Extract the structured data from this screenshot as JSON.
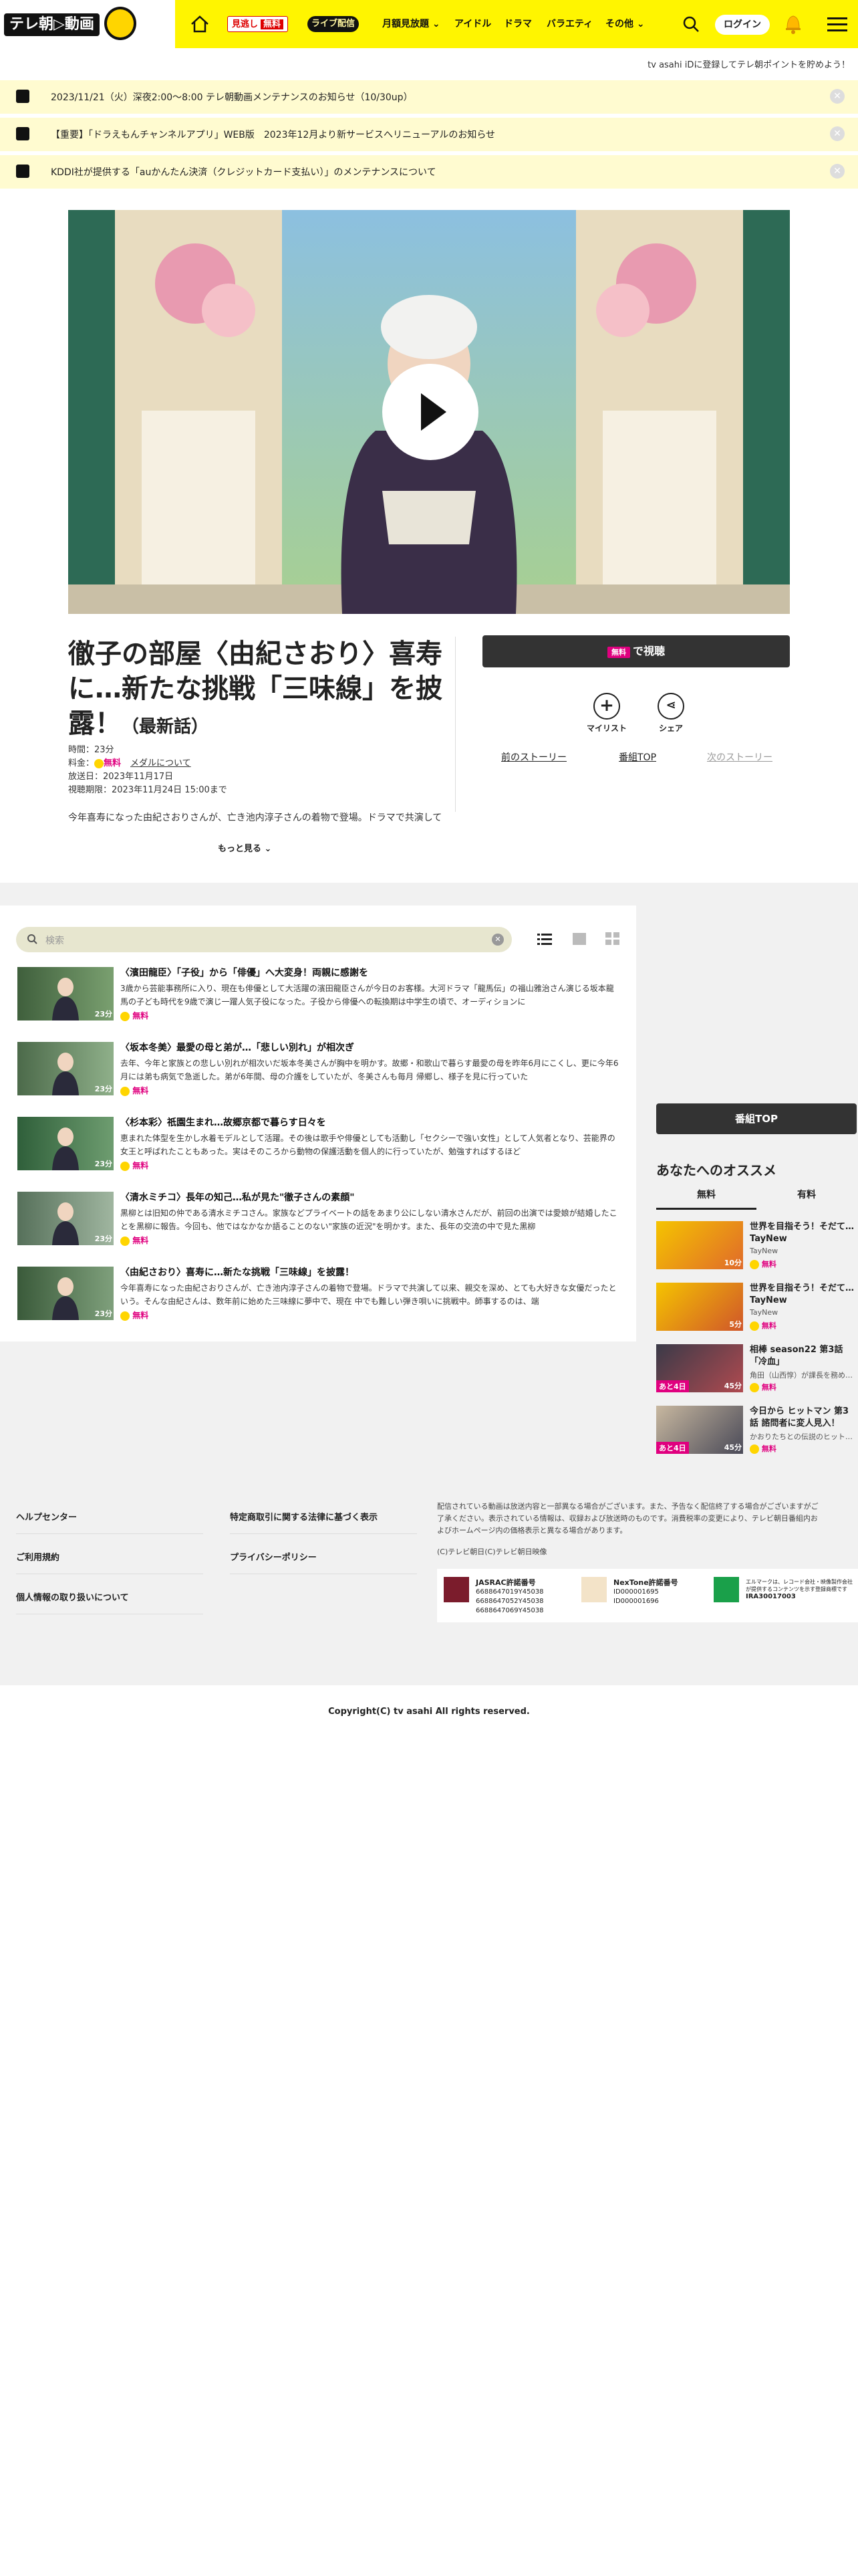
{
  "header": {
    "logo_text": "テレ朝▷動画",
    "mitoshi_label": "見逃し",
    "mitoshi_free": "無料",
    "live_label": "ライブ配信",
    "nav": [
      "月額見放題",
      "アイドル",
      "ドラマ",
      "バラエティ",
      "その他"
    ],
    "login_label": "ログイン",
    "subline": "tv asahi iDに登録してテレ朝ポイントを貯めよう！",
    "colors": {
      "brand_yellow": "#fff500",
      "free_pink": "#e0007f"
    }
  },
  "notices": [
    "2023/11/21（火）深夜2:00〜8:00 テレ朝動画メンテナンスのお知らせ（10/30up）",
    "【重要】「ドラえもんチャンネルアプリ」WEB版　2023年12月より新サービスへリニューアルのお知らせ",
    "KDDI社が提供する「auかんたん決済（クレジットカード支払い）」のメンテナンスについて"
  ],
  "episode": {
    "title": "徹子の部屋〈由紀さおり〉喜寿に…新たな挑戦「三味線」を披露！",
    "latest": "（最新話）",
    "time": "時間：23分",
    "price_prefix": "料金：",
    "price": "無料",
    "media_link": "メダルについて",
    "aired": "放送日：2023年11月17日",
    "expires": "視聴期限：2023年11月24日 15:00まで",
    "description": "今年喜寿になった由紀さおりさんが、亡き池内淳子さんの着物で登場。ドラマで共演して以",
    "more_label": "もっと見る"
  },
  "actions": {
    "watch_free": "無料",
    "watch_label": "で視聴",
    "mylist": "マイリスト",
    "share": "シェア",
    "prev_story": "前のストーリー",
    "program_top": "番組TOP",
    "next_story": "次のストーリー"
  },
  "list": {
    "search_placeholder": "検索",
    "episodes": [
      {
        "title": "〈濱田龍臣〉「子役」から「俳優」へ大変身！両親に感謝を",
        "desc": "3歳から芸能事務所に入り、現在も俳優として大活躍の濱田龍臣さんが今日のお客様。大河ドラマ「龍馬伝」の福山雅治さん演じる坂本龍馬の子ども時代を9歳で演じ一躍人気子役になった。子役から俳優への転換期は中学生の頃で、オーディションに",
        "dur": "23分",
        "free": "無料"
      },
      {
        "title": "〈坂本冬美〉最愛の母と弟が…「悲しい別れ」が相次ぎ",
        "desc": "去年、今年と家族との悲しい別れが相次いだ坂本冬美さんが胸中を明かす。故郷・和歌山で暮らす最愛の母を昨年6月にこくし、更に今年6月には弟も病気で急逝した。弟が6年間、母の介護をしていたが、冬美さんも毎月 帰郷し、様子を見に行っていた",
        "dur": "23分",
        "free": "無料"
      },
      {
        "title": "〈杉本彩〉祇園生まれ…故郷京都で暮らす日々を",
        "desc": "恵まれた体型を生かし水着モデルとして活躍。その後は歌手や俳優としても活動し「セクシーで強い女性」として人気者となり、芸能界の女王と呼ばれたこともあった。実はそのころから動物の保護活動を個人的に行っていたが、勉強すればするほど",
        "dur": "23分",
        "free": "無料"
      },
      {
        "title": "〈清水ミチコ〉長年の知己…私が見た\"徹子さんの素顔\"",
        "desc": "黒柳とは旧知の仲である清水ミチコさん。家族などプライベートの話をあまり公にしない清水さんだが、前回の出演では愛娘が結婚したことを黒柳に報告。今回も、他ではなかなか語ることのない\"家族の近況\"を明かす。また、長年の交流の中で見た黒柳",
        "dur": "23分",
        "free": "無料"
      },
      {
        "title": "〈由紀さおり〉喜寿に…新たな挑戦「三味線」を披露！",
        "desc": "今年喜寿になった由紀さおりさんが、亡き池内淳子さんの着物で登場。ドラマで共演して以来、親交を深め、とても大好きな女優だったという。そんな由紀さんは、数年前に始めた三味線に夢中で、現在 中でも難しい弾き唄いに挑戦中。師事するのは、端",
        "dur": "23分",
        "free": "無料"
      }
    ]
  },
  "sidebar": {
    "program_top": "番組TOP",
    "rec_heading": "あなたへのオススメ",
    "tabs": [
      "無料",
      "有料"
    ],
    "recs": [
      {
        "title": "世界を目指そう！そだて…TayNew",
        "sub": "TayNew",
        "dur": "10分",
        "left": "",
        "free": "無料"
      },
      {
        "title": "世界を目指そう！そだて…TayNew",
        "sub": "TayNew",
        "dur": "5分",
        "left": "",
        "free": "無料"
      },
      {
        "title": "相棒 season22 第3話「冷血」",
        "sub": "角田（山西惇）が課長を務め…",
        "dur": "45分",
        "left": "あと4日",
        "free": "無料"
      },
      {
        "title": "今日から ヒットマン 第3話 諮問者に変人見入！",
        "sub": "かおりたちとの伝説のヒット…",
        "dur": "45分",
        "left": "あと4日",
        "free": "無料"
      }
    ]
  },
  "footer": {
    "links_left": [
      "ヘルプセンター",
      "ご利用規約",
      "個人情報の取り扱いについて"
    ],
    "links_mid": [
      "特定商取引に関する法律に基づく表示",
      "プライバシーポリシー"
    ],
    "note": "配信されている動画は放送内容と一部異なる場合がございます。また、予告なく配信終了する場合がございますがご了承ください。表示されている情報は、収録および放送時のものです。消費税率の変更により、テレビ朝日番組内およびホームページ内の価格表示と異なる場合があります。",
    "copyright_small": "(C)テレビ朝日(C)テレビ朝日映像",
    "jasrac_title": "JASRAC許諾番号",
    "jasrac_nums": [
      "6688647019Y45038",
      "6688647052Y45038",
      "6688647069Y45038"
    ],
    "nextone_title": "NexTone許諾番号",
    "nextone_nums": [
      "ID000001695",
      "ID000001696"
    ],
    "lmark_text": "エルマークは、レコード会社・映像製作会社が提供するコンテンツを示す登録商標です",
    "lmark_num": "IRA30017003",
    "copyright": "Copyright(C) tv asahi All rights reserved."
  }
}
